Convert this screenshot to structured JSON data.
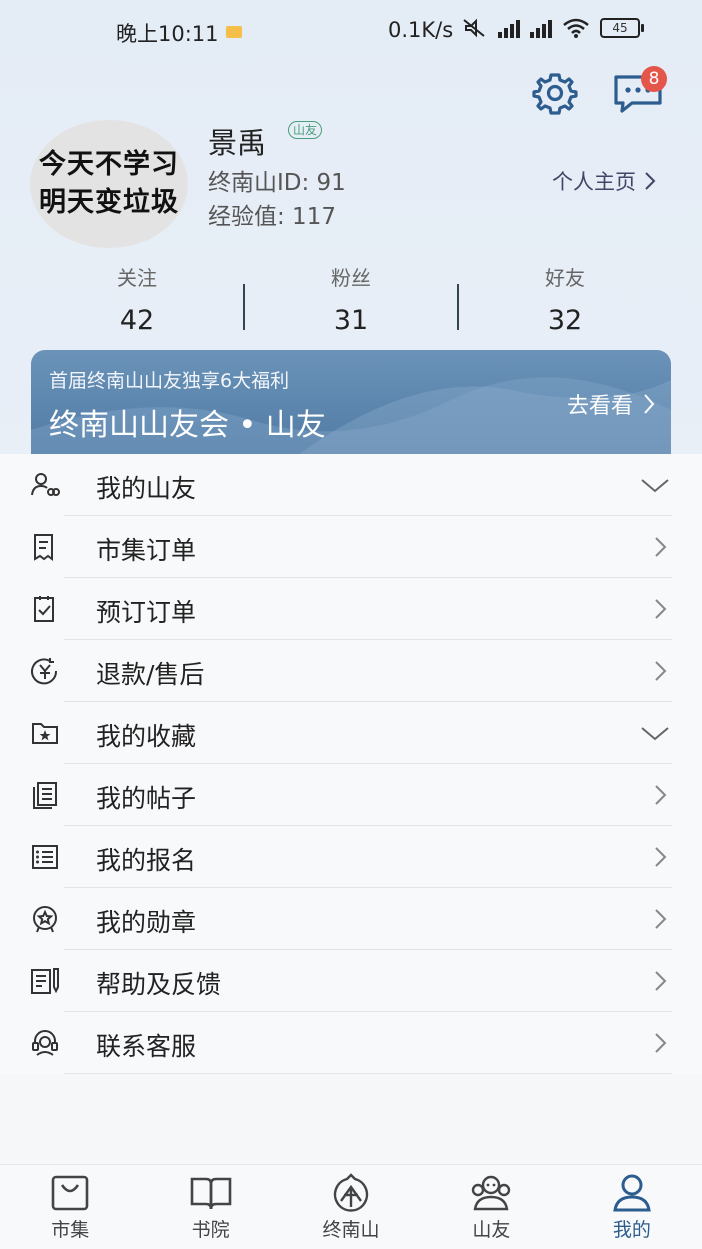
{
  "status_bar": {
    "time": "晚上10:11",
    "speed": "0.1K/s",
    "battery": "45"
  },
  "header": {
    "message_badge": "8"
  },
  "profile": {
    "avatar_text_line1": "今天不学习",
    "avatar_text_line2": "明天变垃圾",
    "name": "景禹",
    "tag": "山友",
    "uid": "终南山ID: 91",
    "exp": "经验值: 117",
    "home_link": "个人主页"
  },
  "stats": [
    {
      "label": "关注",
      "value": "42"
    },
    {
      "label": "粉丝",
      "value": "31"
    },
    {
      "label": "好友",
      "value": "32"
    }
  ],
  "banner": {
    "subtitle": "首届终南山山友独享6大福利",
    "title": "终南山山友会 • 山友",
    "cta": "去看看"
  },
  "menu": [
    {
      "label": "我的山友",
      "icon": "friends-icon",
      "arrow": "down"
    },
    {
      "label": "市集订单",
      "icon": "order-receipt-icon",
      "arrow": "right"
    },
    {
      "label": "预订订单",
      "icon": "booking-check-icon",
      "arrow": "right"
    },
    {
      "label": "退款/售后",
      "icon": "refund-yen-icon",
      "arrow": "right"
    },
    {
      "label": "我的收藏",
      "icon": "star-folder-icon",
      "arrow": "down"
    },
    {
      "label": "我的帖子",
      "icon": "posts-icon",
      "arrow": "right"
    },
    {
      "label": "我的报名",
      "icon": "signup-list-icon",
      "arrow": "right"
    },
    {
      "label": "我的勋章",
      "icon": "medal-icon",
      "arrow": "right"
    },
    {
      "label": "帮助及反馈",
      "icon": "feedback-icon",
      "arrow": "right"
    },
    {
      "label": "联系客服",
      "icon": "customer-service-icon",
      "arrow": "right"
    }
  ],
  "tabs": [
    {
      "label": "市集",
      "icon": "market-bag-icon"
    },
    {
      "label": "书院",
      "icon": "book-icon"
    },
    {
      "label": "终南山",
      "icon": "mountain-emblem-icon"
    },
    {
      "label": "山友",
      "icon": "community-icon"
    },
    {
      "label": "我的",
      "icon": "profile-icon",
      "active": true
    }
  ],
  "colors": {
    "accent": "#2d5d8e",
    "banner": "#5a83ab",
    "badge": "#e4564a",
    "tag_green": "#4a9e78"
  }
}
